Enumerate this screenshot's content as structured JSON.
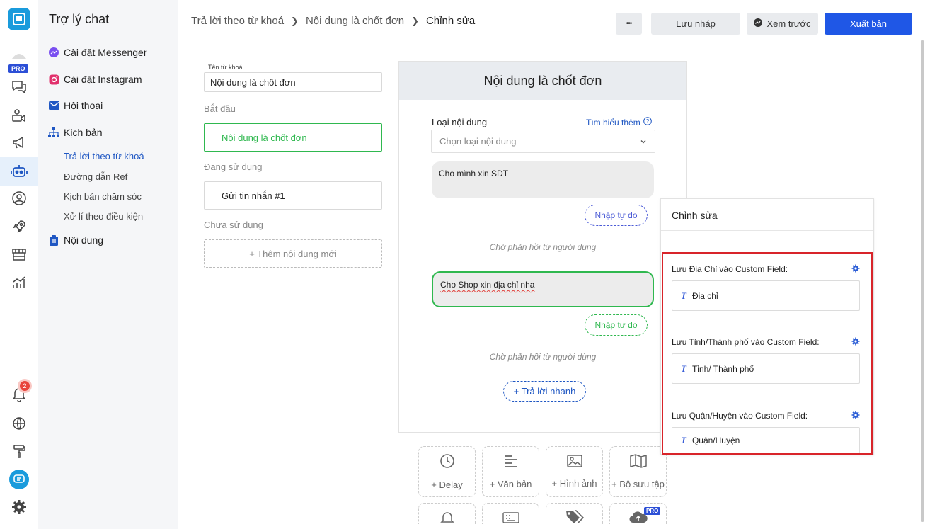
{
  "rail": {
    "pro": "PRO",
    "notifications": "2"
  },
  "sidebar": {
    "title": "Trợ lý chat",
    "items": [
      {
        "label": "Cài đặt Messenger"
      },
      {
        "label": "Cài đặt Instagram"
      },
      {
        "label": "Hội thoại"
      },
      {
        "label": "Kịch bản"
      },
      {
        "label": "Nội dung"
      }
    ],
    "subitems": [
      {
        "label": "Trả lời theo từ khoá"
      },
      {
        "label": "Đường dẫn Ref"
      },
      {
        "label": "Kịch bản chăm sóc"
      },
      {
        "label": "Xử lí theo điều kiện"
      }
    ]
  },
  "header": {
    "breadcrumb": [
      "Trả lời theo từ khoá",
      "Nội dung là chốt đơn",
      "Chỉnh sửa"
    ],
    "more": "•••",
    "save_draft": "Lưu nháp",
    "preview": "Xem trước",
    "publish": "Xuất bản"
  },
  "keyword": {
    "name_label": "Tên từ khoá",
    "name_value": "Nội dung là chốt đơn",
    "start_label": "Bắt đầu",
    "start_card": "Nội dung là chốt đơn",
    "in_use_label": "Đang sử dụng",
    "in_use_card": "Gửi tin nhắn #1",
    "unused_label": "Chưa sử dụng",
    "add_new": "+ Thêm nội dung mới"
  },
  "panel": {
    "title": "Nội dung là chốt đơn",
    "type_label": "Loại nội dung",
    "learn_more": "Tìm hiểu thêm",
    "type_placeholder": "Chọn loại nội dung",
    "msg1": "Cho mình xin  SDT",
    "free_input_1": "Nhập tự do",
    "wait_1": "Chờ phản hồi từ người dùng",
    "msg2": "Cho Shop xin địa chỉ nha",
    "free_input_2": "Nhập tự do",
    "wait_2": "Chờ phản hồi từ người dùng",
    "quick_reply": "+ Trả lời nhanh"
  },
  "tools": [
    {
      "label": "+ Delay",
      "icon": "clock-icon"
    },
    {
      "label": "+ Văn bản",
      "icon": "text-align-icon"
    },
    {
      "label": "+ Hình ảnh",
      "icon": "image-icon"
    },
    {
      "label": "+ Bộ sưu tập",
      "icon": "map-icon"
    }
  ],
  "tools_row2": [
    {
      "icon": "bell-icon"
    },
    {
      "icon": "keyboard-icon"
    },
    {
      "icon": "tags-icon"
    },
    {
      "icon": "cloud-upload-icon",
      "badge": "PRO"
    }
  ],
  "edit": {
    "title": "Chỉnh sửa",
    "fields": [
      {
        "label": "Lưu Địa Chỉ vào Custom Field:",
        "value": "Địa chỉ"
      },
      {
        "label": "Lưu Tỉnh/Thành phố vào Custom Field:",
        "value": "Tỉnh/ Thành phố"
      },
      {
        "label": "Lưu Quận/Huyện vào Custom Field:",
        "value": "Quận/Huyện"
      }
    ],
    "type_glyph": "T"
  },
  "colors": {
    "accent": "#1f57e6",
    "green": "#2fb84f",
    "highlight_red": "#d8242a"
  }
}
